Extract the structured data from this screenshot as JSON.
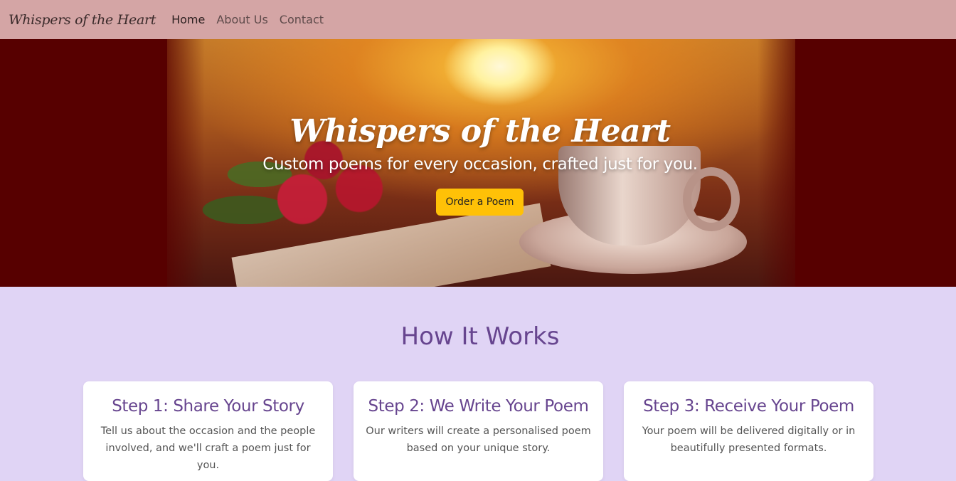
{
  "navbar": {
    "brand": "Whispers of the Heart",
    "links": [
      {
        "label": "Home",
        "active": true
      },
      {
        "label": "About Us",
        "active": false
      },
      {
        "label": "Contact",
        "active": false
      }
    ]
  },
  "hero": {
    "title": "Whispers of the Heart",
    "subtitle": "Custom poems for every occasion, crafted just for you.",
    "cta_label": "Order a Poem"
  },
  "how_it_works": {
    "title": "How It Works",
    "steps": [
      {
        "title": "Step 1: Share Your Story",
        "text": "Tell us about the occasion and the people involved, and we'll craft a poem just for you."
      },
      {
        "title": "Step 2: We Write Your Poem",
        "text": "Our writers will create a personalised poem based on your unique story."
      },
      {
        "title": "Step 3: Receive Your Poem",
        "text": "Your poem will be delivered digitally or in beautifully presented formats."
      }
    ]
  },
  "colors": {
    "navbar_bg": "#d4a5a5",
    "hero_bg": "#570000",
    "cta_bg": "#ffc107",
    "section_bg": "#e0d4f5",
    "heading": "#67458f"
  }
}
